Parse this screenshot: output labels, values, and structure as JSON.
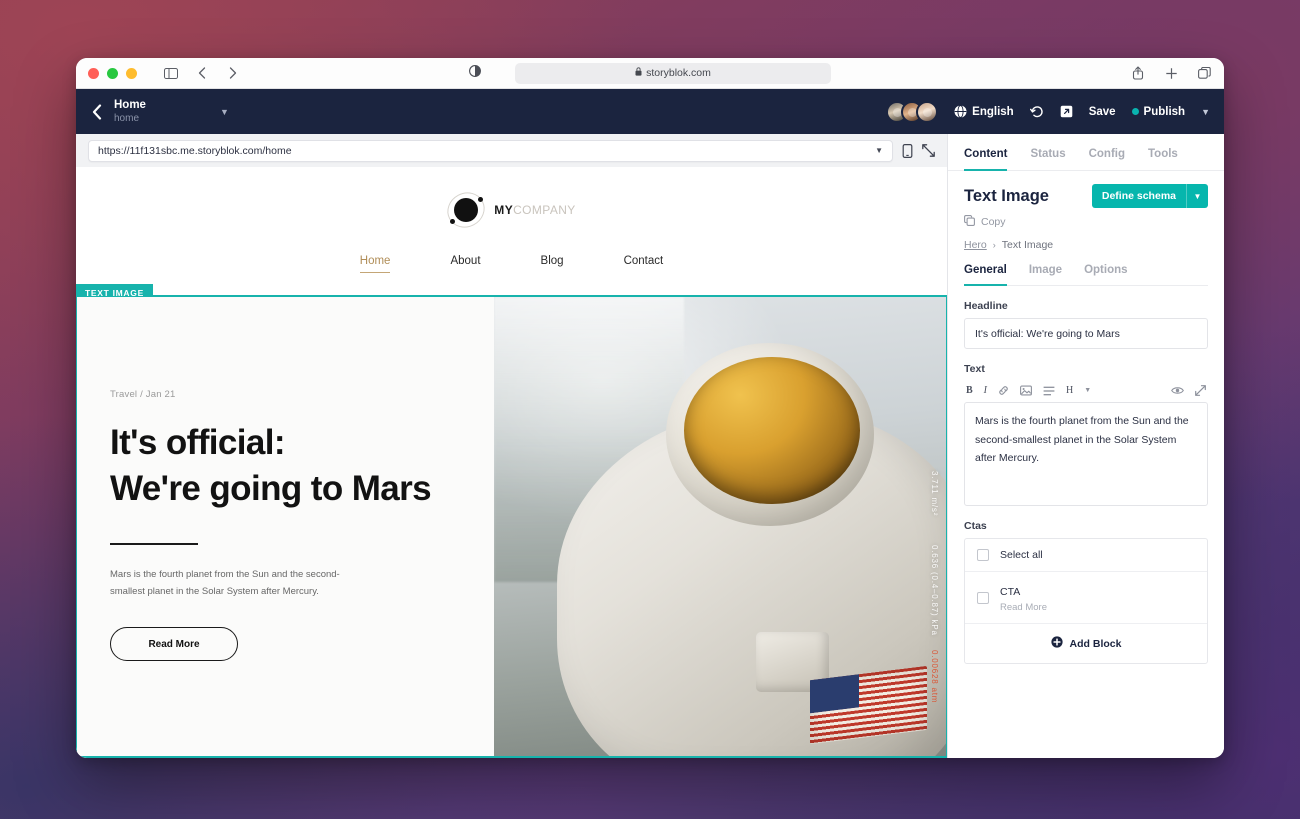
{
  "browser": {
    "traffic_lights": [
      "close",
      "minimize",
      "maximize"
    ],
    "reader_icon": "reader-toggle-icon",
    "sidebar_icon": "sidebar-toggle-icon",
    "back_icon": "nav-back-icon",
    "forward_icon": "nav-forward-icon",
    "address": "storyblok.com",
    "lock_icon": "lock-icon",
    "share_icon": "share-icon",
    "new_tab_icon": "plus-icon",
    "tabs_icon": "tab-overview-icon"
  },
  "topbar": {
    "back_icon": "chevron-left-icon",
    "story_name": "Home",
    "story_slug": "home",
    "story_caret": "chevron-down-icon",
    "avatars": [
      "user-avatar-1",
      "user-avatar-2",
      "user-avatar-3"
    ],
    "language_icon": "globe-icon",
    "language": "English",
    "history_icon": "history-icon",
    "open_icon": "open-external-icon",
    "save_label": "Save",
    "publish_label": "Publish",
    "publish_dot_color": "#09b3af",
    "publish_caret": "chevron-down-icon"
  },
  "preview": {
    "url": "https://11f131sbc.me.storyblok.com/home",
    "url_caret": "chevron-down-icon",
    "device_icon": "mobile-device-icon",
    "fullscreen_icon": "fullscreen-icon"
  },
  "site": {
    "logo": {
      "mark": "orbit-logo-icon",
      "primary": "MY",
      "secondary": "COMPANY"
    },
    "nav": [
      {
        "label": "Home",
        "active": true
      },
      {
        "label": "About",
        "active": false
      },
      {
        "label": "Blog",
        "active": false
      },
      {
        "label": "Contact",
        "active": false
      }
    ],
    "hero": {
      "badge": "TEXT IMAGE",
      "kicker": "Travel / Jan 21",
      "title_line1": "It's official:",
      "title_line2": "We're going to Mars",
      "paragraph": "Mars is the fourth planet from the Sun and the second-smallest planet in the Solar System after Mercury.",
      "cta": "Read More",
      "image_stats": [
        "3.711 m/s²",
        "0.636 (0.4–0.87) kPa",
        "0.00628 atm"
      ]
    }
  },
  "sidebar": {
    "tabs": [
      {
        "label": "Content",
        "active": true
      },
      {
        "label": "Status",
        "active": false
      },
      {
        "label": "Config",
        "active": false
      },
      {
        "label": "Tools",
        "active": false
      }
    ],
    "block_title": "Text Image",
    "schema_button": "Define schema",
    "schema_caret": "chevron-down-icon",
    "copy_icon": "copy-icon",
    "copy_label": "Copy",
    "breadcrumb": {
      "parent": "Hero",
      "separator": "›",
      "current": "Text Image"
    },
    "sub_tabs": [
      {
        "label": "General",
        "active": true
      },
      {
        "label": "Image",
        "active": false
      },
      {
        "label": "Options",
        "active": false
      }
    ],
    "fields": {
      "headline_label": "Headline",
      "headline_value": "It's official: We're going to Mars",
      "text_label": "Text",
      "text_value": "Mars is the fourth planet from the Sun and the second-smallest planet in the Solar System after Mercury.",
      "rich_text_tools": [
        "bold-icon",
        "italic-icon",
        "link-icon",
        "image-icon",
        "list-icon",
        "heading-icon",
        "more-options-caret-icon"
      ],
      "rich_text_right_tools": [
        "preview-eye-icon",
        "expand-icon"
      ],
      "ctas_label": "Ctas",
      "select_all_label": "Select all",
      "cta_item_label": "CTA",
      "cta_item_sub": "Read More",
      "add_block_icon": "plus-circle-icon",
      "add_block_label": "Add Block"
    }
  },
  "colors": {
    "accent_teal": "#17b3ac",
    "navy": "#1b243f",
    "nav_active": "#b08d57"
  }
}
